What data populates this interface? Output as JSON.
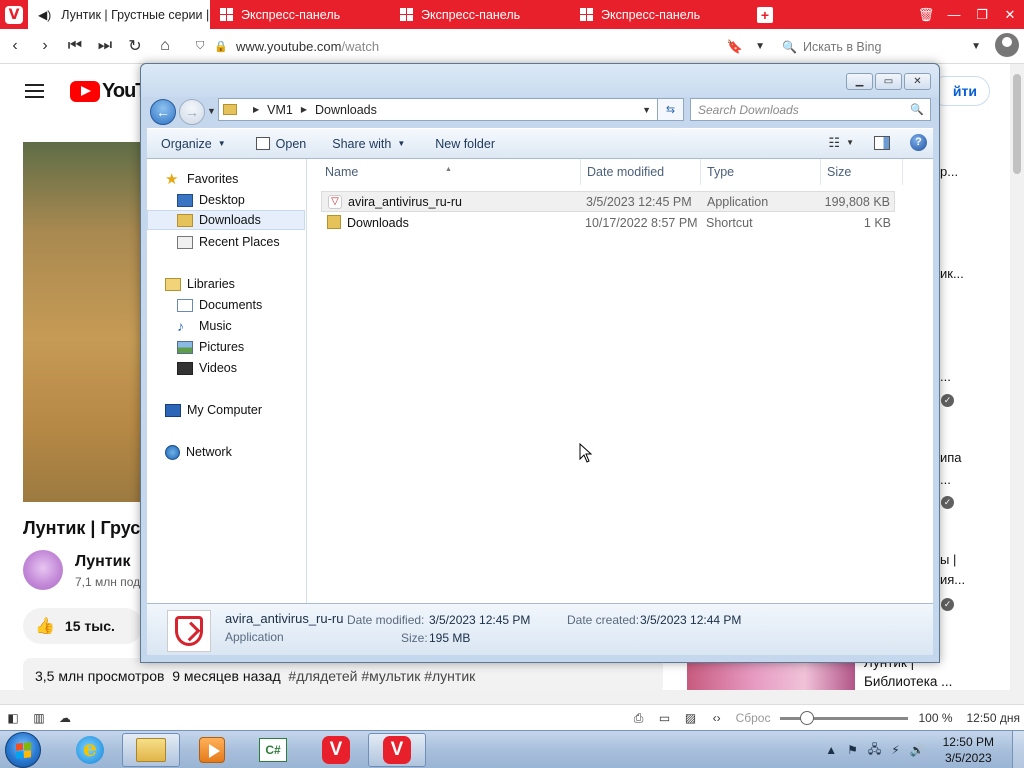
{
  "browser": {
    "tabs": [
      {
        "label": "Лунтик | Грустные серии |",
        "active": true
      },
      {
        "label": "Экспресс-панель",
        "active": false
      },
      {
        "label": "Экспресс-панель",
        "active": false
      },
      {
        "label": "Экспресс-панель",
        "active": false
      }
    ],
    "url_domain": "www.youtube.com",
    "url_path": "/watch",
    "search_placeholder": "Искать в Bing",
    "status": {
      "reset_label": "Сброс",
      "zoom": "100 %",
      "clock": "12:50 дня"
    },
    "accent_color": "#e8202b"
  },
  "youtube": {
    "logo_text": "YouTu",
    "login_label": "йти",
    "video_title": "Лунтик | Груст",
    "channel_name": "Лунтик",
    "subscribers": "7,1 млн под",
    "likes": "15 тыс.",
    "description_views": "3,5 млн просмотров",
    "description_age": "9 месяцев назад",
    "description_tags": "#длядетей #мультик #лунтик",
    "sidebar_fragments": [
      "р...",
      "ик...",
      "...",
      "ипа",
      "...",
      "ы |",
      "ия...",
      "Лунтик |",
      "Библиотека ..."
    ]
  },
  "explorer": {
    "path": [
      "VM1",
      "Downloads"
    ],
    "search_placeholder": "Search Downloads",
    "toolbar": {
      "organize": "Organize",
      "open": "Open",
      "share_with": "Share with",
      "new_folder": "New folder"
    },
    "nav": {
      "favorites": "Favorites",
      "desktop": "Desktop",
      "downloads": "Downloads",
      "recent_places": "Recent Places",
      "libraries": "Libraries",
      "documents": "Documents",
      "music": "Music",
      "pictures": "Pictures",
      "videos": "Videos",
      "my_computer": "My Computer",
      "network": "Network"
    },
    "columns": {
      "name": "Name",
      "date_modified": "Date modified",
      "type": "Type",
      "size": "Size"
    },
    "files": [
      {
        "name": "avira_antivirus_ru-ru",
        "date": "3/5/2023 12:45 PM",
        "type": "Application",
        "size": "199,808 KB"
      },
      {
        "name": "Downloads",
        "date": "10/17/2022 8:57 PM",
        "type": "Shortcut",
        "size": "1 KB"
      }
    ],
    "details": {
      "name": "avira_antivirus_ru-ru",
      "type": "Application",
      "date_modified_label": "Date modified:",
      "date_modified": "3/5/2023 12:45 PM",
      "date_created_label": "Date created:",
      "date_created": "3/5/2023 12:44 PM",
      "size_label": "Size:",
      "size": "195 MB"
    }
  },
  "taskbar": {
    "time": "12:50 PM",
    "date": "3/5/2023",
    "csharp_label": "C#"
  }
}
